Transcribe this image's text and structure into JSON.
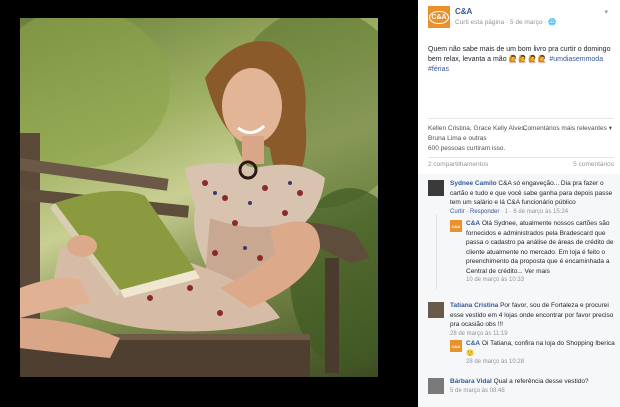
{
  "post": {
    "page_name": "C&A",
    "logo_text": "C&A",
    "publisher": "Curti esta página",
    "date": "5 de março",
    "caption": "Quem não sabe mais de um bom livro pra curtir o domingo bem relax, levanta a mão",
    "emojis": "🙋🙋🙋🙋",
    "hashtag": "#umdiasemmoda #férias"
  },
  "reactions": {
    "names": "Kellen Cristina, Grace Kelly Alves, Bruna Lima e outras",
    "count": "600 pessoas curtiram isso.",
    "filter": "Comentários mais relevantes ▾"
  },
  "stats": {
    "shares": "2 compartilhamentos",
    "comments": "5 comentários"
  },
  "comments": [
    {
      "author": "Sydnee Camilo",
      "text": "C&A só engaveção... Dia pra fazer o cartão e tudo e que você sabe ganha para depois passe tem um salário e lá C&A funcionário público",
      "meta_link": "Curtir · Responder",
      "meta": "1 · 6 de março às 15:24"
    },
    {
      "author": "C&A",
      "text": "Olá Sydnee, atualmente nossos cartões são fornecidos e administrados pela Bradescard que passa o cadastro pa análise de áreas de crédito de cliente atualmente no mercado. Em loja é feito o preenchimento da proposta que é encaminhada a Central de crédito... Ver mais",
      "meta": "10 de março às 10:33"
    },
    {
      "author": "Tatiana Cristina",
      "text": "Por favor, sou de Fortaleza e procurei esse vestido em 4 lojas onde encontrar por favor preciso pra ocasião obs !!!",
      "meta": "28 de março às 11:19"
    },
    {
      "author": "C&A",
      "text": "Oi Tatiana, confira na loja do Shopping Iberica 🙂",
      "meta": "28 de março às 10:28"
    },
    {
      "author": "Bárbara Vidal",
      "text": "Qual a referência desse vestido?",
      "meta": "5 de março às 08:48"
    }
  ]
}
